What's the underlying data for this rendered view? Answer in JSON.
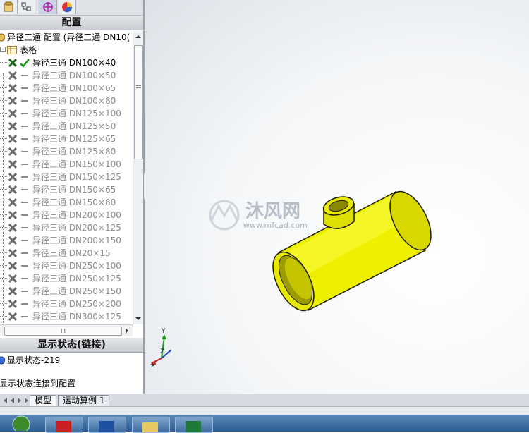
{
  "toolbar": {
    "icons": [
      "feature-manager-icon",
      "property-manager-icon",
      "configuration-manager-icon",
      "display-manager-icon"
    ]
  },
  "config_section": {
    "header": "配置",
    "root_label": "异径三通 配置 (异径三通 DN10(",
    "table_label": "表格",
    "active_config": "异径三通 DN100×40",
    "configs": [
      "异径三通 DN100×50",
      "异径三通 DN100×65",
      "异径三通 DN100×80",
      "异径三通 DN125×100",
      "异径三通 DN125×50",
      "异径三通 DN125×65",
      "异径三通 DN125×80",
      "异径三通 DN150×100",
      "异径三通 DN150×125",
      "异径三通 DN150×65",
      "异径三通 DN150×80",
      "异径三通 DN200×100",
      "异径三通 DN200×125",
      "异径三通 DN200×150",
      "异径三通 DN20×15",
      "异径三通 DN250×100",
      "异径三通 DN250×125",
      "异径三通 DN250×150",
      "异径三通 DN250×200",
      "异径三通 DN300×125"
    ],
    "hscroll_grip": "III"
  },
  "display_section": {
    "header": "显示状态(链接)",
    "state": "显示状态-219",
    "note": "显示状态连接到配置"
  },
  "viewport": {
    "watermark_brand": "沐风网",
    "watermark_url": "www.mfcad.com",
    "axis_x": "X",
    "axis_y": "Y",
    "axis_z": "Z"
  },
  "tabs": [
    "模型",
    "运动算例 1"
  ],
  "colors": {
    "part": "#f2f200",
    "part_edge": "#2a2a00",
    "active_check": "#1a9a1a",
    "inactive_text": "#8c8c8c"
  }
}
